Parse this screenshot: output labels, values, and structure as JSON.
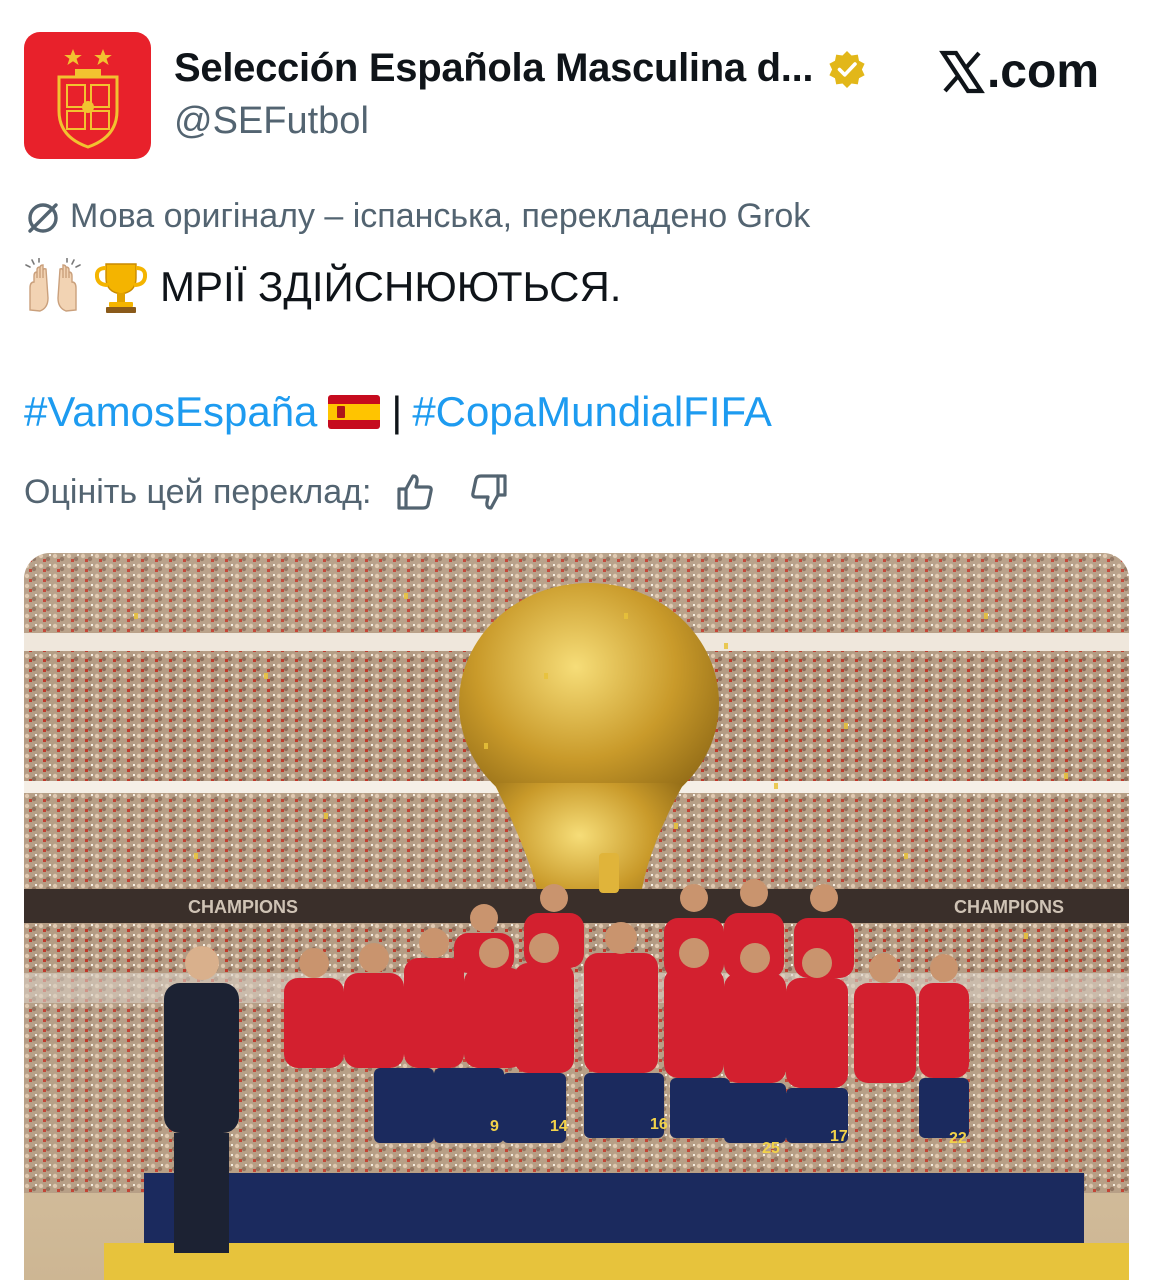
{
  "header": {
    "display_name": "Selección Española Masculina d...",
    "handle": "@SEFutbol",
    "site": ".com",
    "site_logo": "x-logo-icon",
    "avatar_icon": "rfef-crest-icon",
    "verified_icon": "verified-gold-badge-icon"
  },
  "translation": {
    "note": "Мова оригіналу – іспанська, перекладено Grok",
    "icon": "slashed-circle-icon"
  },
  "tweet": {
    "emoji_1": "raising-hands-emoji",
    "emoji_2": "trophy-emoji",
    "text": "МРІЇ ЗДІЙСНЮЮТЬСЯ."
  },
  "hashtags": {
    "first": "#VamosEspaña",
    "flag": "spain-flag-emoji",
    "separator": "|",
    "second": "#CopaMundialFIFA"
  },
  "rating": {
    "prompt": "Оцініть цей переклад:",
    "like_icon": "thumbs-up-icon",
    "dislike_icon": "thumbs-down-icon"
  },
  "media": {
    "description_icon": "team-celebration-photo",
    "banner_left": "CHAMPIONS",
    "banner_right": "CHAMPIONS",
    "jersey_numbers": [
      "9",
      "14",
      "16",
      "25",
      "17",
      "22"
    ]
  },
  "colors": {
    "accent": "#1d9bf0",
    "secondary_text": "#536471",
    "avatar_bg": "#e8212b",
    "verified_gold": "#e2b719",
    "jersey_red": "#d3202f",
    "shorts_navy": "#1b2a5e"
  }
}
